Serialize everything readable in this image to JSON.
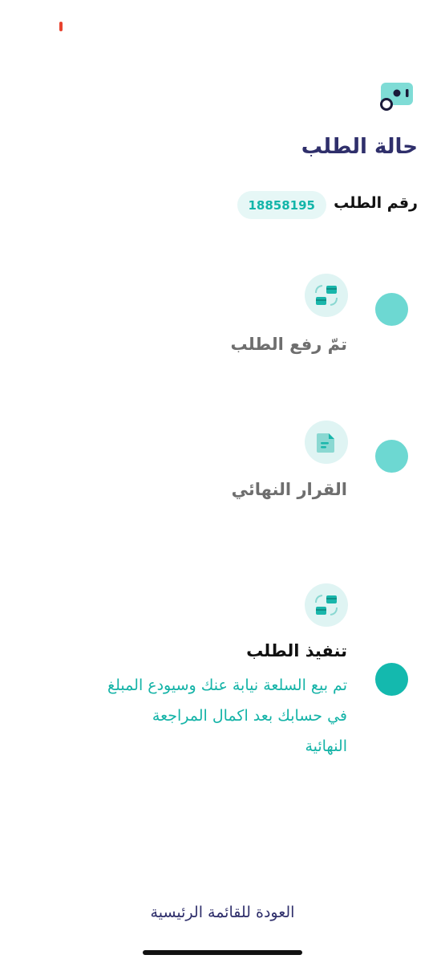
{
  "header": {
    "title": "حالة الطلب"
  },
  "order": {
    "label": "رقم الطلب",
    "number": "18858195"
  },
  "steps": [
    {
      "title": "تمّ رفع الطلب",
      "icon": "swap-cards-icon",
      "state": "done"
    },
    {
      "title": "القرار النهائي",
      "icon": "document-icon",
      "state": "done"
    },
    {
      "title": "تنفيذ الطلب",
      "icon": "swap-cards-icon",
      "state": "current",
      "description": "تم بيع السلعة نيابة عنك وسيودع المبلغ في حسابك بعد اكمال المراجعة النهائية"
    }
  ],
  "footer": {
    "back_label": "العودة للقائمة الرئيسية"
  },
  "colors": {
    "accent": "#14b9ae",
    "dot_done": "#6dd8d2",
    "title": "#2f2f6b",
    "icon_bg": "#dff4f3"
  }
}
